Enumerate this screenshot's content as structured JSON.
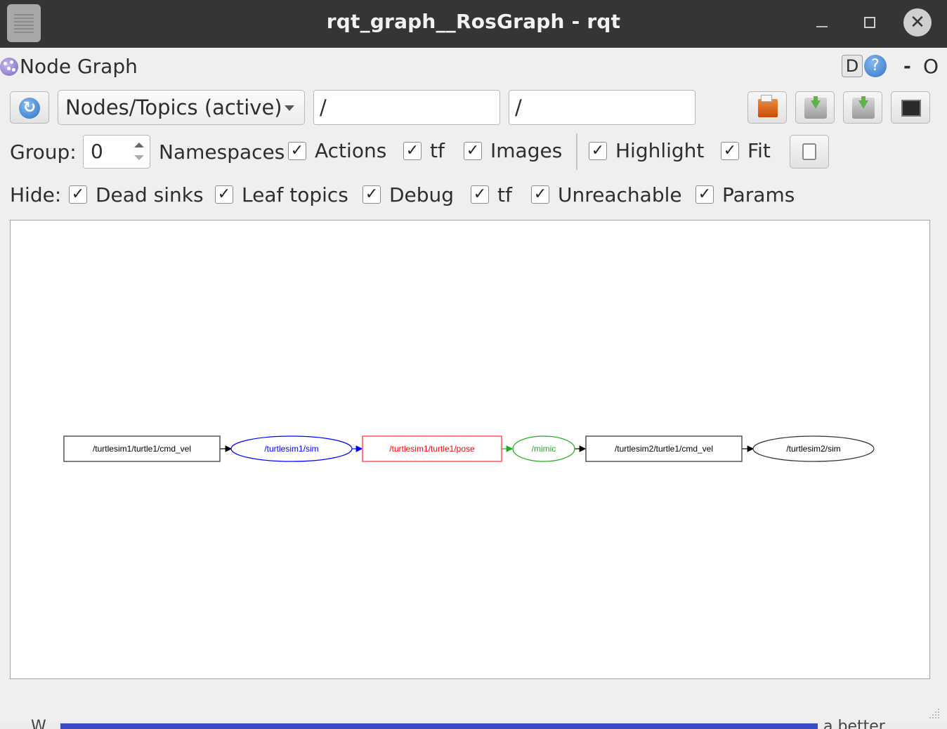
{
  "window": {
    "title": "rqt_graph__RosGraph - rqt",
    "controls": {
      "minimize": "–",
      "maximize": "□",
      "close": "✕"
    }
  },
  "plugin": {
    "title": "Node Graph",
    "d_label": "D",
    "help_label": "?",
    "dash_label": "-",
    "o_label": "O"
  },
  "toolbar": {
    "refresh_icon": "↻",
    "mode_select": "Nodes/Topics (active)",
    "node_filter": "/",
    "topic_filter": "/"
  },
  "group_row": {
    "group_label": "Group:",
    "group_value": "0",
    "namespaces_label": "Namespaces",
    "checkboxes": [
      {
        "label": "Actions",
        "checked": true
      },
      {
        "label": "tf",
        "checked": true
      },
      {
        "label": "Images",
        "checked": true
      },
      {
        "label": "Highlight",
        "checked": true
      },
      {
        "label": "Fit",
        "checked": true
      }
    ],
    "check_mark": "✓"
  },
  "hide_row": {
    "hide_label": "Hide:",
    "checkboxes": [
      {
        "label": "Dead sinks",
        "checked": true
      },
      {
        "label": "Leaf topics",
        "checked": true
      },
      {
        "label": "Debug",
        "checked": true
      },
      {
        "label": "tf",
        "checked": true
      },
      {
        "label": "Unreachable",
        "checked": true
      },
      {
        "label": "Params",
        "checked": true
      }
    ]
  },
  "graph": {
    "nodes": [
      {
        "label": "/turtlesim1/turtle1/cmd_vel",
        "shape": "box",
        "color": "#000000"
      },
      {
        "label": "/turtlesim1/sim",
        "shape": "ellipse",
        "color": "#0000ff"
      },
      {
        "label": "/turtlesim1/turtle1/pose",
        "shape": "box",
        "color": "#ff0000"
      },
      {
        "label": "/mimic",
        "shape": "ellipse",
        "color": "#22aa22"
      },
      {
        "label": "/turtlesim2/turtle1/cmd_vel",
        "shape": "box",
        "color": "#000000"
      },
      {
        "label": "/turtlesim2/sim",
        "shape": "ellipse",
        "color": "#000000"
      }
    ]
  },
  "background": {
    "left_text": "W",
    "right_text": "a better"
  }
}
